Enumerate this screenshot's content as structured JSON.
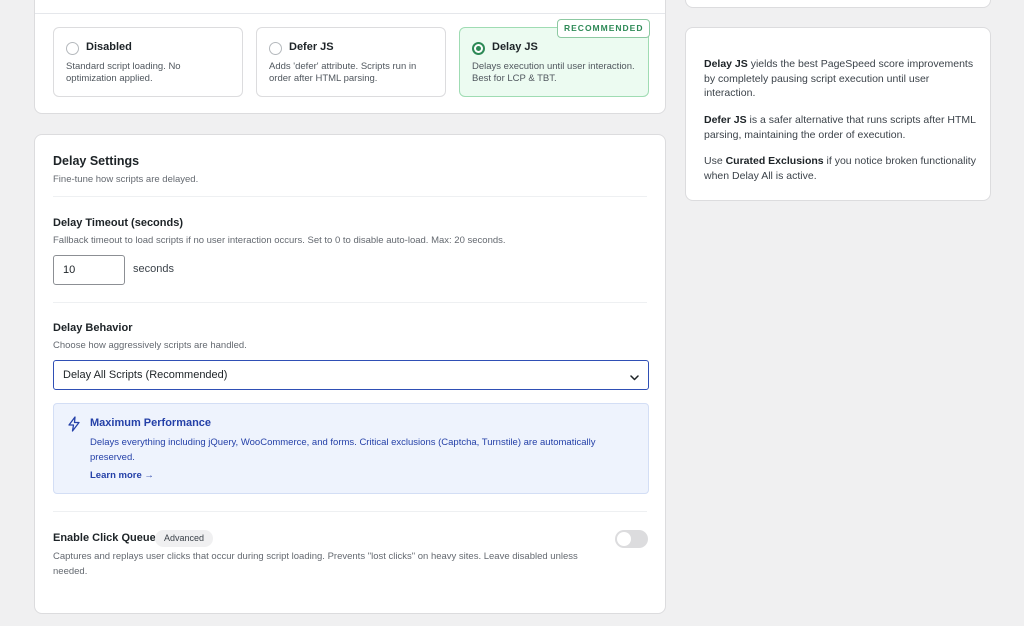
{
  "mode": {
    "options": [
      {
        "title": "Disabled",
        "desc": "Standard script loading. No optimization applied."
      },
      {
        "title": "Defer JS",
        "desc": "Adds 'defer' attribute. Scripts run in order after HTML parsing."
      },
      {
        "title": "Delay JS",
        "desc": "Delays execution until user interaction. Best for LCP & TBT."
      }
    ],
    "selected": "Delay JS",
    "recommended_badge": "RECOMMENDED"
  },
  "side": {
    "p1_bold": "Delay JS",
    "p1_rest": " yields the best PageSpeed score improvements by completely pausing script execution until user interaction.",
    "p2_bold": "Defer JS",
    "p2_rest": " is a safer alternative that runs scripts after HTML parsing, maintaining the order of execution.",
    "p3_pre": "Use ",
    "p3_bold": "Curated Exclusions",
    "p3_rest": " if you notice broken functionality when Delay All is active."
  },
  "settings": {
    "title": "Delay Settings",
    "subtitle": "Fine-tune how scripts are delayed.",
    "timeout": {
      "label": "Delay Timeout (seconds)",
      "help": "Fallback timeout to load scripts if no user interaction occurs. Set to 0 to disable auto-load. Max: 20 seconds.",
      "value": "10",
      "unit": "seconds"
    },
    "behavior": {
      "label": "Delay Behavior",
      "help": "Choose how aggressively scripts are handled.",
      "selected": "Delay All Scripts (Recommended)"
    },
    "info": {
      "title": "Maximum Performance",
      "desc": "Delays everything including jQuery, WooCommerce, and forms. Critical exclusions (Captcha, Turnstile) are automatically preserved.",
      "link": "Learn more →"
    },
    "click_queue": {
      "label": "Enable Click Queue",
      "tag": "Advanced",
      "help": "Captures and replays user clicks that occur during script loading. Prevents \"lost clicks\" on heavy sites. Leave disabled unless needed.",
      "enabled": false
    }
  },
  "colors": {
    "accent_green": "#2e8a57",
    "accent_blue": "#2541a8",
    "select_border": "#2f4fb5"
  }
}
